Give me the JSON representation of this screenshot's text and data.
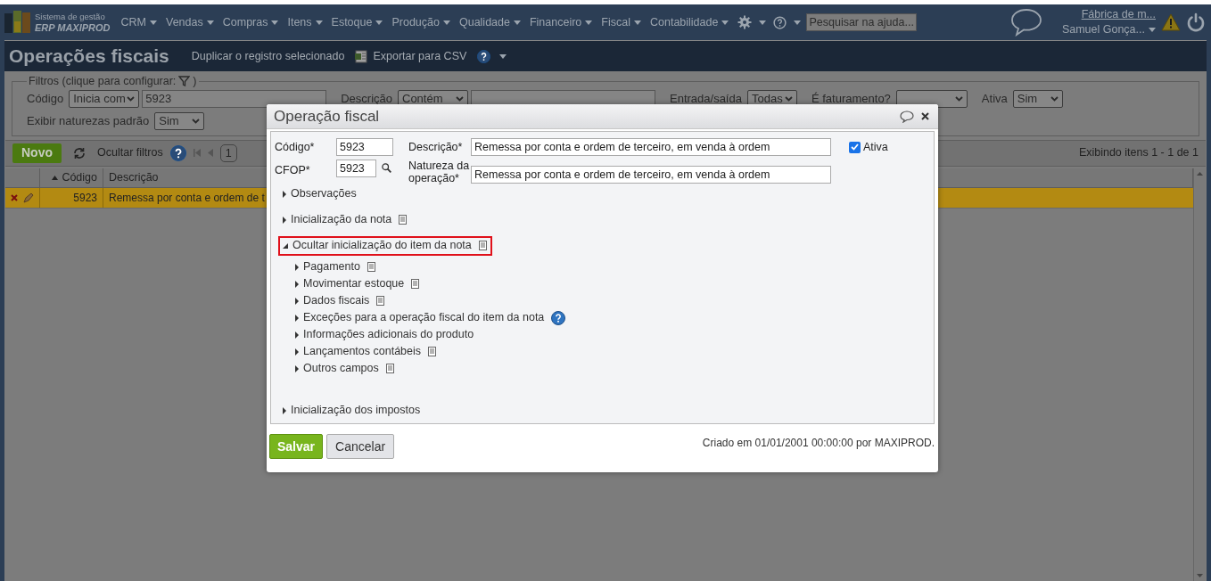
{
  "nav": {
    "logo_line1": "Sistema de gestão",
    "logo_line2": "ERP MAXIPROD",
    "menus": [
      "CRM",
      "Vendas",
      "Compras",
      "Itens",
      "Estoque",
      "Produção",
      "Qualidade",
      "Financeiro",
      "Fiscal",
      "Contabilidade"
    ],
    "search": {
      "placeholder": "Pesquisar na ajuda..."
    },
    "company": "Fábrica de m...",
    "user": "Samuel Gonça..."
  },
  "page": {
    "title": "Operações fiscais",
    "actions": [
      {
        "kind": "plain",
        "label": "Duplicar o registro selecionado"
      },
      {
        "kind": "export",
        "label": "Exportar para CSV"
      }
    ]
  },
  "filters": {
    "legend": "Filtros (clique para configurar:",
    "legend_end": ")",
    "rows": [
      [
        {
          "kind": "text",
          "label": "Código",
          "operator": "Inicia com",
          "value": "5923"
        },
        {
          "kind": "text",
          "label": "Descrição",
          "operator": "Contém"
        },
        {
          "kind": "select",
          "label": "Entrada/saída",
          "value": "Todas"
        },
        {
          "kind": "select",
          "label": "É faturamento?"
        },
        {
          "kind": "select",
          "label": "Ativa",
          "value": "Sim"
        }
      ],
      [
        {
          "kind": "select",
          "label": "Exibir naturezas padrão",
          "value": "Sim"
        }
      ]
    ]
  },
  "toolbar": {
    "new_button": "Novo",
    "hide_filters": "Ocultar filtros",
    "page": "1",
    "summary": "Exibindo itens 1 - 1 de 1"
  },
  "grid": {
    "columns": [
      {
        "label": "Código",
        "sorted": true
      },
      {
        "label": "Descrição",
        "sorted": false
      }
    ],
    "rows": [
      {
        "cells": [
          "5923",
          "Remessa por conta e ordem de t"
        ],
        "selected": true
      }
    ]
  },
  "dialog": {
    "title": "Operação fiscal",
    "codigo": {
      "label": "Código*",
      "value": "5923"
    },
    "cfop": {
      "label": "CFOP*",
      "value": "5923"
    },
    "descricao": {
      "label": "Descrição*",
      "value": "Remessa por conta e ordem de terceiro, em venda à ordem"
    },
    "natureza": {
      "label": "Natureza da operação*",
      "value": "Remessa por conta e ordem de terceiro, em venda à ordem"
    },
    "ativa": {
      "label": "Ativa",
      "checked": true
    },
    "sections": [
      {
        "label": "Observações",
        "expanded": false,
        "highlighted": false
      },
      {
        "label": "Inicialização da nota",
        "kind": "note",
        "expanded": false,
        "highlighted": false
      },
      {
        "label": "Ocultar inicialização do item da nota",
        "kind": "note",
        "expanded": true,
        "highlighted": true,
        "children": [
          {
            "label": "Pagamento",
            "kind": "note",
            "expanded": false
          },
          {
            "label": "Movimentar estoque",
            "kind": "note",
            "expanded": false
          },
          {
            "label": "Dados fiscais",
            "kind": "note",
            "expanded": false
          },
          {
            "label": "Exceções para a operação fiscal do item da nota",
            "kind": "help",
            "expanded": false
          },
          {
            "label": "Informações adicionais do produto",
            "expanded": false
          },
          {
            "label": "Lançamentos contábeis",
            "kind": "note",
            "expanded": false
          },
          {
            "label": "Outros campos",
            "kind": "note",
            "expanded": false
          }
        ]
      },
      {
        "label": "Inicialização dos impostos",
        "expanded": false,
        "highlighted": false
      }
    ],
    "save": "Salvar",
    "cancel": "Cancelar",
    "created": "Criado em 01/01/2001 00:00:00 por MAXIPROD."
  }
}
